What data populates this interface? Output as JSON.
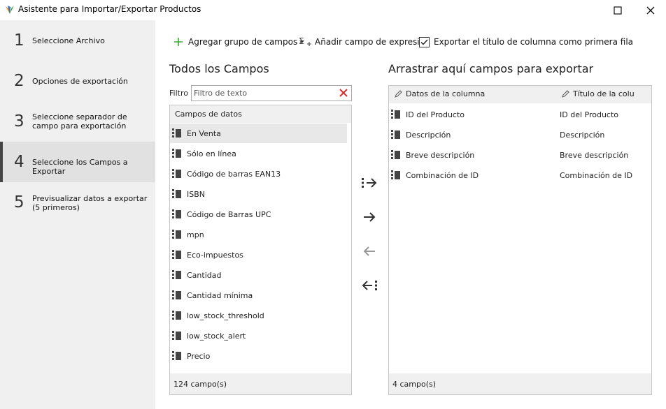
{
  "window": {
    "title": "Asistente para Importar/Exportar Productos",
    "colors": {
      "logo_orange": "#f28c28",
      "logo_green": "#3aaa35",
      "logo_blue": "#2f6fb5"
    }
  },
  "sidebar": {
    "steps": [
      {
        "number": "1",
        "label": "Seleccione Archivo"
      },
      {
        "number": "2",
        "label": "Opciones de exportación"
      },
      {
        "number": "3",
        "label": "Seleccione separador de campo para exportación"
      },
      {
        "number": "4",
        "label": "Seleccione los Campos a Exportar",
        "active": true
      },
      {
        "number": "5",
        "label": "Previsualizar datos a exportar (5 primeros)"
      }
    ]
  },
  "toolbar": {
    "add_group_label": "Agregar grupo de campos",
    "add_expression_label": "Añadir campo de expresión",
    "export_title_label": "Exportar el título de columna como primera fila",
    "export_title_checked": true,
    "accent_color": "#3aaa35"
  },
  "left": {
    "title": "Todos los Campos",
    "filter_label": "Filtro",
    "filter_placeholder": "Filtro de texto",
    "header": "Campos de datos",
    "items": [
      "En Venta",
      "Sólo en línea",
      "Código de barras EAN13",
      "ISBN",
      "Código de Barras UPC",
      "mpn",
      "Eco-impuestos",
      "Cantidad",
      "Cantidad mínima",
      "low_stock_threshold",
      "low_stock_alert",
      "Precio"
    ],
    "footer": "124 campo(s)"
  },
  "right": {
    "title": "Arrastrar aquí campos para exportar",
    "col1": "Datos de la columna",
    "col2": "Título de la colu",
    "rows": [
      {
        "data": "ID del Producto",
        "title": "ID del Producto"
      },
      {
        "data": "Descripción",
        "title": "Descripción"
      },
      {
        "data": "Breve descripción",
        "title": "Breve descripción"
      },
      {
        "data": "Combinación de ID",
        "title": "Combinación de ID"
      }
    ],
    "footer": "4 campo(s)"
  }
}
